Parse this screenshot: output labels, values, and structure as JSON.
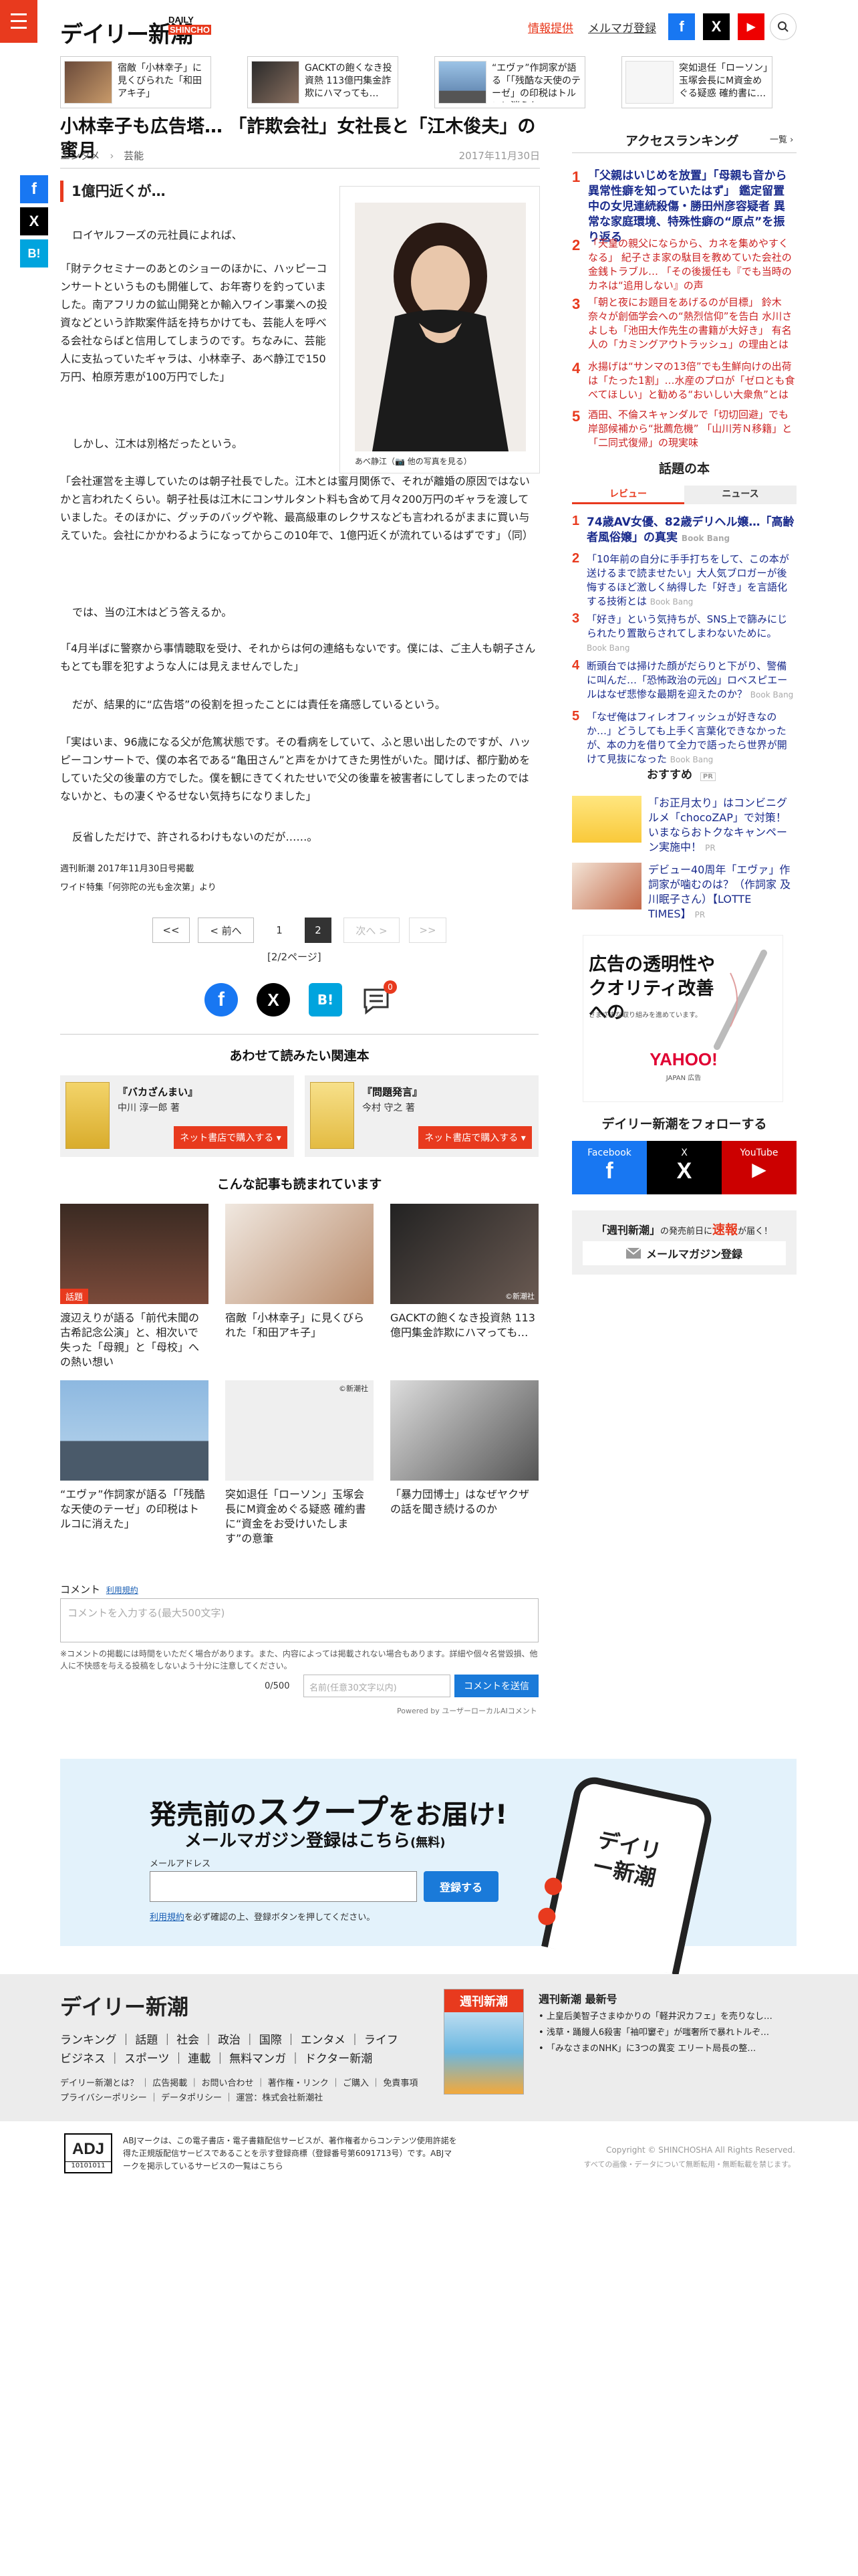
{
  "header": {
    "logo_jp": "デイリー新潮",
    "logo_en_1": "DAILY",
    "logo_en_2": "SHINCHO",
    "info_link": "情報提供",
    "mail_link": "メルマガ登録",
    "social": [
      "f",
      "X",
      "▶"
    ]
  },
  "top_strip": [
    {
      "text": "宿敵「小林幸子」に見くびられた「和田アキ子」"
    },
    {
      "text": "GACKTの飽くなき投資熱 113億円集金詐欺にハマっても…"
    },
    {
      "text": "“エヴァ”作詞家が語る「「残酷な天使のテーゼ」の印税はトルコに消えた…"
    },
    {
      "text": "突如退任「ローソン」玉塚会長にM資金めぐる疑惑 確約書に…"
    }
  ],
  "article": {
    "title": "小林幸子も広告塔… 「詐欺会社」女社長と「江木俊夫」の蜜月",
    "crumb_1": "エンタメ",
    "crumb_sep": "›",
    "crumb_2": "芸能",
    "date": "2017年11月30日",
    "subhead": "1億円近くが…",
    "photo_caption": "あべ静江（📷 他の写真を見る）",
    "p1": "ロイヤルフーズの元社員によれば、",
    "p2": "「財テクセミナーのあとのショーのほかに、ハッピーコンサートというものも開催して、お年寄りを釣っていました。南アフリカの鉱山開発とか輸入ワイン事業への投資などという詐欺案件話を持ちかけても、芸能人を呼べる会社ならばと信用してしまうのです。ちなみに、芸能人に支払っていたギャラは、小林幸子、あべ静江で150万円、柏原芳恵が100万円でした」",
    "p3": "しかし、江木は別格だったという。",
    "p4": "「会社運営を主導していたのは朝子社長でした。江木とは蜜月関係で、それが離婚の原因ではないかと言われたくらい。朝子社長は江木にコンサルタント料も含めて月々200万円のギャラを渡していました。そのほかに、グッチのバッグや靴、最高級車のレクサスなども言われるがままに買い与えていた。会社にかかわるようになってからこの10年で、1億円近くが流れているはずです」（同）",
    "p5": "では、当の江木はどう答えるか。",
    "p6": "「4月半ばに警察から事情聴取を受け、それからは何の連絡もないです。僕には、ご主人も朝子さんもとても罪を犯すような人には見えませんでした」",
    "p7": "だが、結果的に“広告塔”の役割を担ったことには責任を痛感しているという。",
    "p8": "「実はいま、96歳になる父が危篤状態です。その看病をしていて、ふと思い出したのですが、ハッピーコンサートで、僕の本名である“亀田さん”と声をかけてきた男性がいた。聞けば、都庁勤めをしていた父の後輩の方でした。僕を観にきてくれたせいで父の後輩を被害者にしてしまったのではないかと、もの凄くやるせない気持ちになりました」",
    "p9": "反省しただけで、許されるわけもないのだが……。",
    "source_1": "週刊新潮 2017年11月30日号掲載",
    "source_2": "ワイド特集「何弥陀の光も金次第」より"
  },
  "pager": {
    "first": "<<",
    "prev": "< 前へ",
    "p1": "1",
    "p2": "2",
    "next": "次へ >",
    "last": ">>",
    "info": "[2/2ページ]"
  },
  "share": {
    "hatena": "B!",
    "comment_badge": "0"
  },
  "related_books": {
    "heading": "あわせて読みたい関連本",
    "items": [
      {
        "title": "『バカざんまい』",
        "author": "中川 淳一郎 著",
        "button": "ネット書店で購入する ▾"
      },
      {
        "title": "『問題発言』",
        "author": "今村 守之 著",
        "button": "ネット書店で購入する ▾"
      }
    ]
  },
  "read_more": {
    "heading": "こんな記事も読まれています",
    "tag": "話題",
    "credit": "©新潮社",
    "items": [
      "渡辺えりが語る「前代未聞の古希記念公演」と、相次いで失った「母親」と「母校」への熱い想い",
      "宿敵「小林幸子」に見くびられた「和田アキ子」",
      "GACKTの飽くなき投資熱 113億円集金詐欺にハマっても…",
      "“エヴァ”作詞家が語る「「残酷な天使のテーゼ」の印税はトルコに消えた」",
      "突如退任「ローソン」玉塚会長にM資金めぐる疑惑 確約書に“資金をお受けいたします”の意筆",
      "「暴力団博士」はなぜヤクザの話を聞き続けるのか"
    ]
  },
  "comment": {
    "label": "コメント",
    "terms": "利用規約",
    "placeholder": "コメントを入力する(最大500文字)",
    "note": "※コメントの掲載には時間をいただく場合があります。また、内容によっては掲載されない場合もあります。詳細や個々名誉毀損、他人に不快感を与える投稿をしないよう十分に注意してください。",
    "count": "0/500",
    "name_placeholder": "名前(任意30文字以内)",
    "submit": "コメントを送信",
    "powered": "Powered by ユーザーローカルAIコメント"
  },
  "banner": {
    "line1a": "発売前の",
    "line1b": "スクープ",
    "line1c": "をお届け!",
    "line2": "メールマガジン登録はこちら",
    "line2b": "(無料)",
    "email_label": "メールアドレス",
    "register": "登録する",
    "note_link": "利用規約",
    "note": "を必ず確認の上、登録ボタンを押してください。",
    "phone_text": "デイリー新潮"
  },
  "sidebar": {
    "ranking_title": "アクセスランキング",
    "ranking_more": "一覧 ›",
    "ranking": [
      {
        "n": "1",
        "t": "「父親はいじめを放置」「母親も音から異常性癖を知っていたはず」 鑑定留置中の女児連続殺傷・勝田州彦容疑者 異常な家庭環境、特殊性癖の“原点”を振り返る"
      },
      {
        "n": "2",
        "t": "「天皇の親父にならから、カネを集めやすくなる」 紀子さま家の駄目を教めていた会社の金銭トラブル… 「その後援任も『でも当時のカネは“追用しない』の声"
      },
      {
        "n": "3",
        "t": "「朝と夜にお題目をあげるのが目標」 鈴木奈々が創価学会への“熱烈信仰”を告白 水川さよしも「池田大作先生の書籍が大好き」 有名人の「カミングアウトラッシュ」の理由とは"
      },
      {
        "n": "4",
        "t": "水揚げは“サンマの13倍”でも生鮮向けの出荷は「たった1割」…水産のプロが「ゼロとも食べてほしい」と勧める“おいしい大衆魚”とは"
      },
      {
        "n": "5",
        "t": "酒田、不倫スキャンダルで「切切回避」でも岸部候補から“批薦危機” 「山川芳Ｎ移籍」と「二同式復帰」の現実味"
      }
    ],
    "books_title": "話題の本",
    "tab_review": "レビュー",
    "tab_news": "ニュース",
    "books": [
      {
        "n": "1",
        "t": "74歳AV女優、82歳デリヘル嬢…「高齢者風俗嬢」の真実",
        "by": "Book Bang"
      },
      {
        "n": "2",
        "t": "「10年前の自分に手手打ちをして、この本が送けるまで読ませたい」大人気ブロガーが後悔するほど激しく納得した「好き」を言語化する技術とは",
        "by": "Book Bang"
      },
      {
        "n": "3",
        "t": "「好き」という気持ちが、SNS上で篩みにじられたり置散らされてしまわないために。",
        "by": "Book Bang"
      },
      {
        "n": "4",
        "t": "断頭台では掃けた顔がだらりと下がり、警備に叫んだ…「恐怖政治の元凶」ロベスピエールはなぜ悲惨な最期を迎えたのか？",
        "by": "Book Bang"
      },
      {
        "n": "5",
        "t": "「なぜ俺はフィレオフィッシュが好きなのか…」どうしても上手く言葉化できなかったが、本の力を借りて全力で語ったら世界が開けて見抜になった",
        "by": "Book Bang"
      }
    ],
    "recommend_title": "おすすめ",
    "recommend_pr": "PR",
    "recommend": [
      {
        "t": "「お正月太り」はコンビニグルメ「chocoZAP」で対策！いまならおトクなキャンペーン実施中！",
        "pr": "PR"
      },
      {
        "t": "デビュー40周年「エヴァ」作詞家が噛むのは？（作詞家 及川眠子さん）【LOTTE TIMES】",
        "pr": "PR"
      }
    ],
    "ad_line1": "広告の透明性や",
    "ad_line2": "クオリティ改善への",
    "ad_line3": "さまざまな取り組みを進めています。",
    "ad_yahoo": "YAHOO!",
    "ad_yahoo_sub": "JAPAN 広告",
    "follow_title": "デイリー新潮をフォローする",
    "follow": [
      {
        "name": "Facebook",
        "icon": "f"
      },
      {
        "name": "X",
        "icon": "X"
      },
      {
        "name": "YouTube",
        "icon": "▶"
      }
    ],
    "mail_title_a": "「週刊新潮」",
    "mail_title_b": "の発売前日に",
    "mail_title_c": "速報",
    "mail_title_d": "が届く！",
    "mail_button": "メールマガジン登録"
  },
  "footer": {
    "logo_jp": "デイリー新潮",
    "nav1": [
      "ランキング",
      "話題",
      "社会",
      "政治",
      "国際",
      "エンタメ",
      "ライフ"
    ],
    "nav2": [
      "ビジネス",
      "スポーツ",
      "連載",
      "無料マンガ",
      "ドクター新潮"
    ],
    "links1": "デイリー新潮とは？ ｜ 広告掲載 ｜ お問い合わせ ｜ 著作権・リンク ｜ ご購入 ｜ 免責事項",
    "links2": "プライバシーポリシー ｜ データポリシー ｜ 運営：株式会社新潮社",
    "mag_name": "週刊新潮",
    "latest_title": "週刊新潮 最新号",
    "latest": [
      "上皇后美智子さまゆかりの「軽井沢カフェ」を売りなし…",
      "浅草・踊饅人6殺害「袖叩窶ぞ」が嗤奢所で暴れトルぞ…",
      "「みなさまのNHK」に3つの異変 エリート局長の整…"
    ],
    "adj": "ADJ",
    "adj_num": "10101011",
    "adj_text": "ABJマークは、この電子書店・電子書籍配信サービスが、著作権者からコンテンツ使用許諾を得た正規版配信サービスであることを示す登録商標（登録番号第6091713号）です。ABJマークを掲示しているサービスの一覧はこちら",
    "copyright": "Copyright © SHINCHOSHA All Rights Reserved.",
    "copyright2": "すべての画像・データについて無断転用・無断転載を禁じます。"
  }
}
